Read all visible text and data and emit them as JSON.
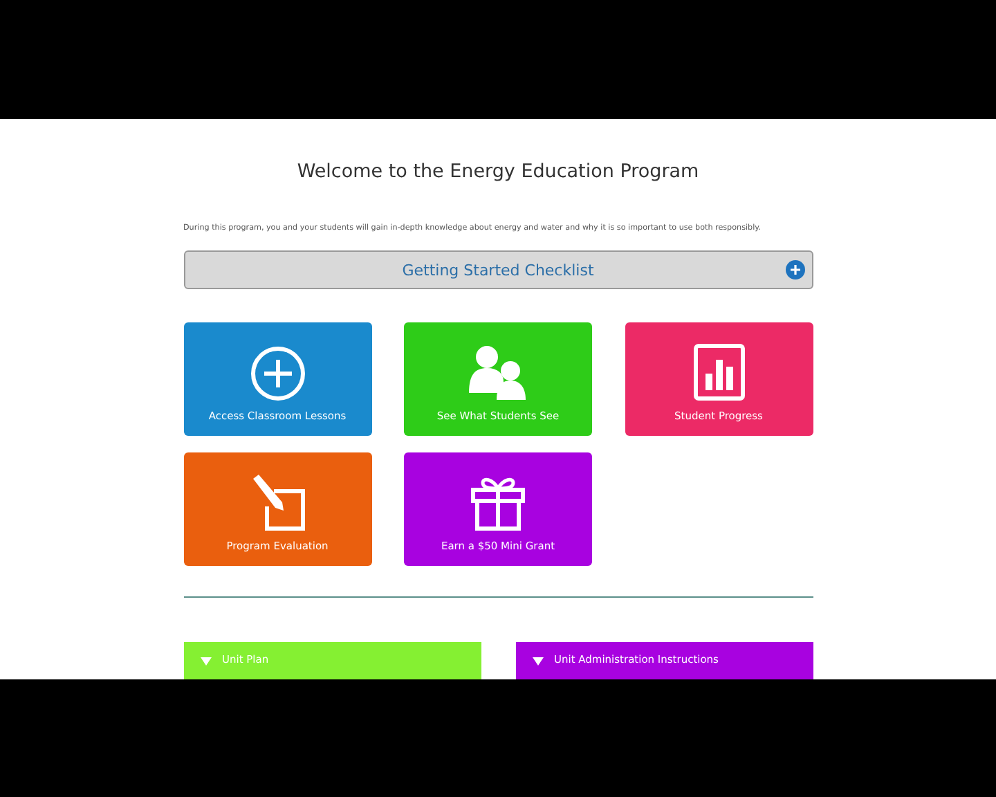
{
  "title": "Welcome to the Energy Education Program",
  "intro": "During this program, you and your students will gain in-depth knowledge about energy and water and why it is so important to use both responsibly.",
  "checklist": {
    "label": "Getting Started Checklist",
    "expanded": false
  },
  "tiles": [
    {
      "label": "Access Classroom Lessons",
      "color": "#1a8acd"
    },
    {
      "label": "See What Students See",
      "color": "#2ecc18"
    },
    {
      "label": "Student Progress",
      "color": "#ec2a66"
    },
    {
      "label": "Program Evaluation",
      "color": "#ea5f0e"
    },
    {
      "label": "Earn a $50 Mini Grant",
      "color": "#a802e0"
    }
  ],
  "panels": [
    {
      "label": "Unit Plan",
      "color": "#85f032",
      "expanded": false
    },
    {
      "label": "Unit Administration Instructions",
      "color": "#a802e0",
      "expanded": false
    }
  ]
}
